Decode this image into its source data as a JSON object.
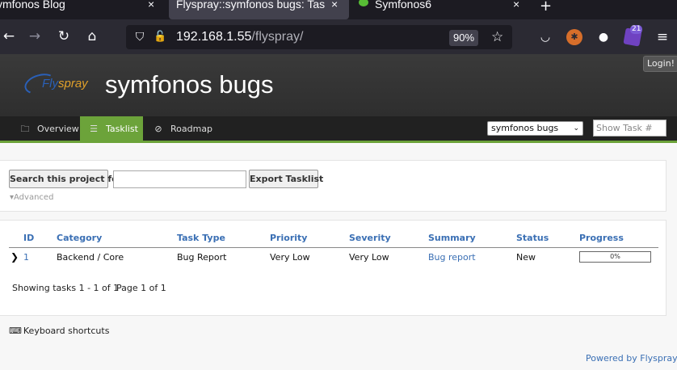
{
  "browser": {
    "tabs": [
      {
        "title": "ymfonos Blog",
        "close": "×"
      },
      {
        "title": "Flyspray::symfonos bugs: Tas",
        "close": "×"
      },
      {
        "title": "Symfonos6",
        "close": "×"
      }
    ],
    "new_tab": "+",
    "url_host": "192.168.1.55",
    "url_path": "/flyspray/",
    "zoom": "90%",
    "extension_badge": "21",
    "icons": {
      "back": "←",
      "forward": "→",
      "reload": "↻",
      "home": "⌂",
      "shield": "⛉",
      "lock": "🔓",
      "star": "☆",
      "pocket": "◡",
      "cookie": "●",
      "menu": "≡"
    }
  },
  "header": {
    "login_label": "Login!",
    "logo_fly": "Fly",
    "logo_spray": "spray",
    "site_title": "symfonos bugs"
  },
  "menu": {
    "overview": "Overview",
    "tasklist": "Tasklist",
    "roadmap": "Roadmap",
    "project_select": "symfonos bugs",
    "show_task_placeholder": "Show Task #"
  },
  "search": {
    "search_button": "Search this project for",
    "search_value": "",
    "export_button": "Export Tasklist",
    "advanced": "▾Advanced"
  },
  "tasks": {
    "columns": [
      "ID",
      "Category",
      "Task Type",
      "Priority",
      "Severity",
      "Summary",
      "Status",
      "Progress"
    ],
    "rows": [
      {
        "id": "1",
        "category": "Backend / Core",
        "task_type": "Bug Report",
        "priority": "Very Low",
        "severity": "Very Low",
        "summary": "Bug report",
        "status": "New",
        "progress": "0%"
      }
    ],
    "progress_fraction": 0,
    "showing": "Showing tasks 1 - 1 of 1",
    "page_of": "Page 1 of 1"
  },
  "footer": {
    "keyboard_shortcuts": "Keyboard shortcuts",
    "powered_by": "Powered by Flyspray"
  },
  "colors": {
    "accent_green": "#6ca33a",
    "link_blue": "#3a6fb4",
    "header_dark": "#2e2e2e"
  }
}
